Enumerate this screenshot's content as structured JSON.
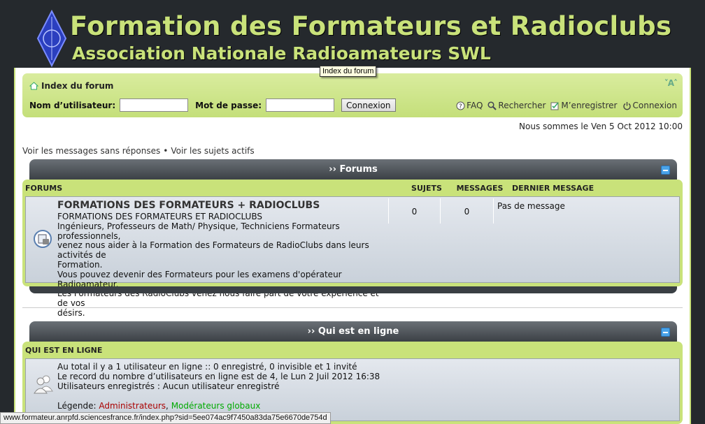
{
  "header": {
    "title": "Formation des Formateurs et Radioclubs",
    "subtitle": "Association Nationale Radioamateurs SWL"
  },
  "tooltip": "Index du forum",
  "breadcrumb": {
    "label": "Index du forum"
  },
  "font_toggle": "A",
  "login": {
    "username_label": "Nom d’utilisateur:",
    "password_label": "Mot de passe:",
    "username_value": "",
    "password_value": "",
    "button_label": "Connexion"
  },
  "quick_links": {
    "faq": "FAQ",
    "search": "Rechercher",
    "register": "M’enregistrer",
    "login": "Connexion"
  },
  "datetime": "Nous sommes le Ven 5 Oct 2012 10:00",
  "links": {
    "unanswered": "Voir les messages sans réponses",
    "separator": "•",
    "active": "Voir les sujets actifs"
  },
  "forums_section": {
    "heading": "›› Forums",
    "columns": {
      "forums": "FORUMS",
      "topics": "SUJETS",
      "messages": "MESSAGES",
      "last": "DERNIER MESSAGE"
    },
    "forum": {
      "title": "FORMATIONS DES FORMATEURS + RADIOCLUBS",
      "desc_lines": [
        "FORMATIONS DES FORMATEURS ET RADIOCLUBS",
        "Ingénieurs, Professeurs de Math/ Physique, Techniciens Formateurs professionnels,",
        "venez nous aider à la Formation des Formateurs de RadioClubs dans leurs activités de",
        "Formation.",
        "Vous pouvez devenir des Formateurs pour les examens d'opérateur Radioamateur.",
        "Les Formateurs des RadioClubs venez nous faire part de votre expérience et de vos",
        "désirs."
      ],
      "topics": "0",
      "messages": "0",
      "last": "Pas de message"
    }
  },
  "online_section": {
    "heading": "›› Qui est en ligne",
    "column": "QUI EST EN LIGNE",
    "lines": [
      "Au total il y a 1 utilisateur en ligne :: 0 enregistré, 0 invisible et 1 invité",
      "Le record du nombre d’utilisateurs en ligne est de 4, le Lun 2 Juil 2012 16:38",
      "Utilisateurs enregistrés : Aucun utilisateur enregistré"
    ],
    "legend_label": "Légende:",
    "legend_admin": "Administrateurs",
    "legend_sep": ",",
    "legend_gmod": "Modérateurs globaux"
  },
  "statusbar": "www.formateur.anrpfd.sciencesfrance.fr/index.php?sid=5ee074ac9f7450a83da75e6670de754d",
  "colors": {
    "accent": "#c9e27a",
    "header_bg": "#25292d",
    "admin": "#aa0000",
    "gmod": "#00aa00"
  }
}
